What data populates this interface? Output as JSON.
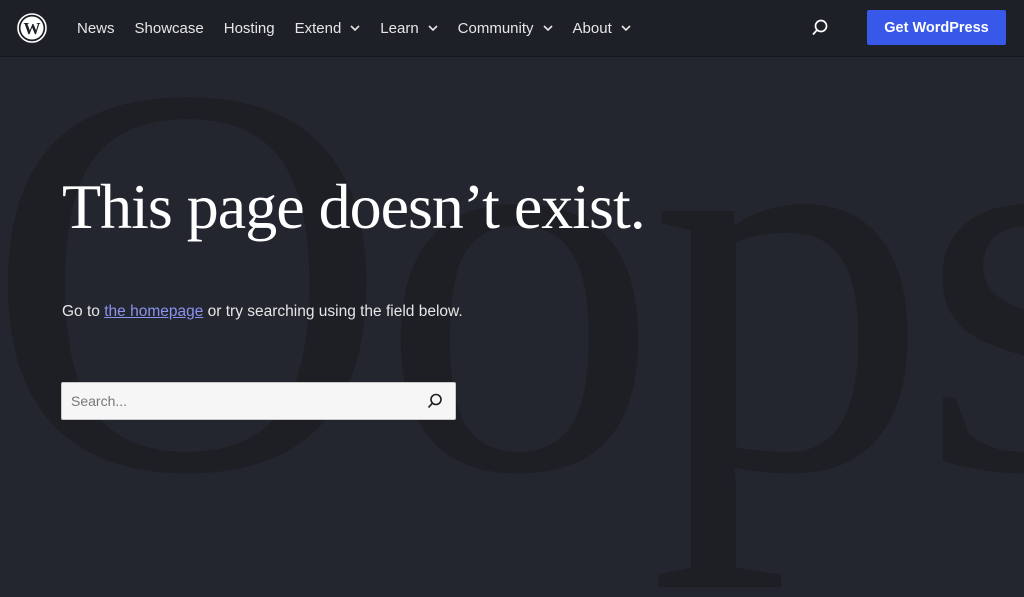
{
  "header": {
    "logo": "wordpress-logo",
    "nav": [
      {
        "label": "News",
        "has_dropdown": false
      },
      {
        "label": "Showcase",
        "has_dropdown": false
      },
      {
        "label": "Hosting",
        "has_dropdown": false
      },
      {
        "label": "Extend",
        "has_dropdown": true
      },
      {
        "label": "Learn",
        "has_dropdown": true
      },
      {
        "label": "Community",
        "has_dropdown": true
      },
      {
        "label": "About",
        "has_dropdown": true
      }
    ],
    "search_icon": "search-icon",
    "cta_label": "Get WordPress",
    "cta_color": "#3858e9"
  },
  "main": {
    "background_word": "Oops!",
    "title": "This page doesn’t exist.",
    "lead_prefix": "Go to ",
    "lead_link": "the homepage",
    "lead_suffix": " or try searching using the field below.",
    "search": {
      "placeholder": "Search...",
      "value": ""
    }
  },
  "colors": {
    "background": "#23262f",
    "header": "#1e2027",
    "link": "#8a94ee"
  }
}
